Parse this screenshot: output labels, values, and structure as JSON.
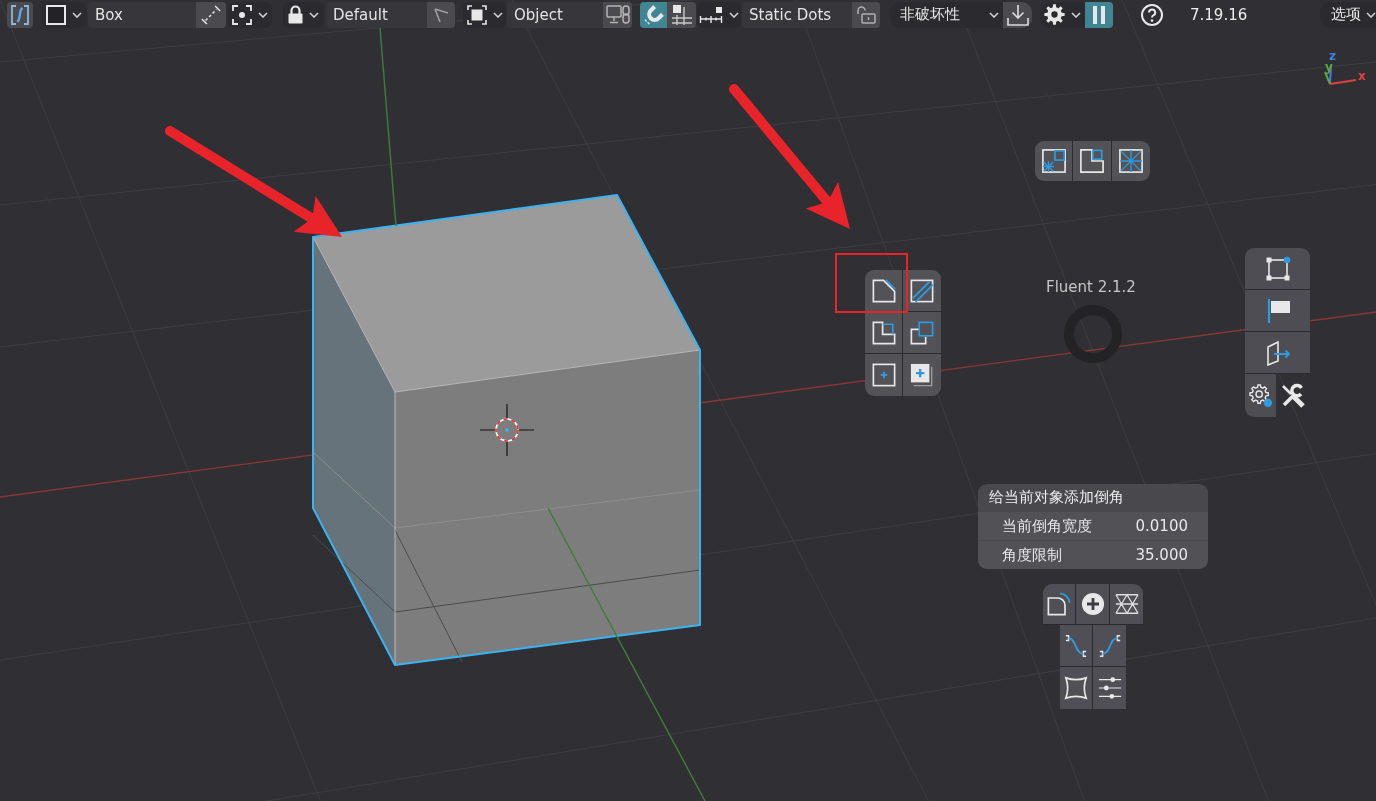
{
  "header": {
    "fields": [
      {
        "value": "Box"
      },
      {
        "value": "Default"
      },
      {
        "value": "Object"
      },
      {
        "value": "Static Dots"
      }
    ],
    "snapping": {
      "on": true
    },
    "mode": {
      "value": "非破坏性"
    },
    "pause": {
      "on": true
    },
    "version": "7.19.16",
    "options": {
      "label": "选项"
    }
  },
  "viewport": {
    "axis_gizmo": [
      {
        "label": "z",
        "color": "#3c7ee8"
      },
      {
        "label": "y",
        "color": "#5ea63d"
      },
      {
        "label": "x",
        "color": "#e04040"
      }
    ],
    "fluent": {
      "title": "Fluent 2.1.2"
    },
    "side_tabs": [
      {
        "selected": true
      },
      {
        "selected": false
      }
    ],
    "bevel_panel": {
      "title": "给当前对象添加倒角",
      "rows": [
        {
          "label": "当前倒角宽度",
          "value": "0.0100"
        },
        {
          "label": "角度限制",
          "value": "35.000"
        }
      ]
    }
  }
}
